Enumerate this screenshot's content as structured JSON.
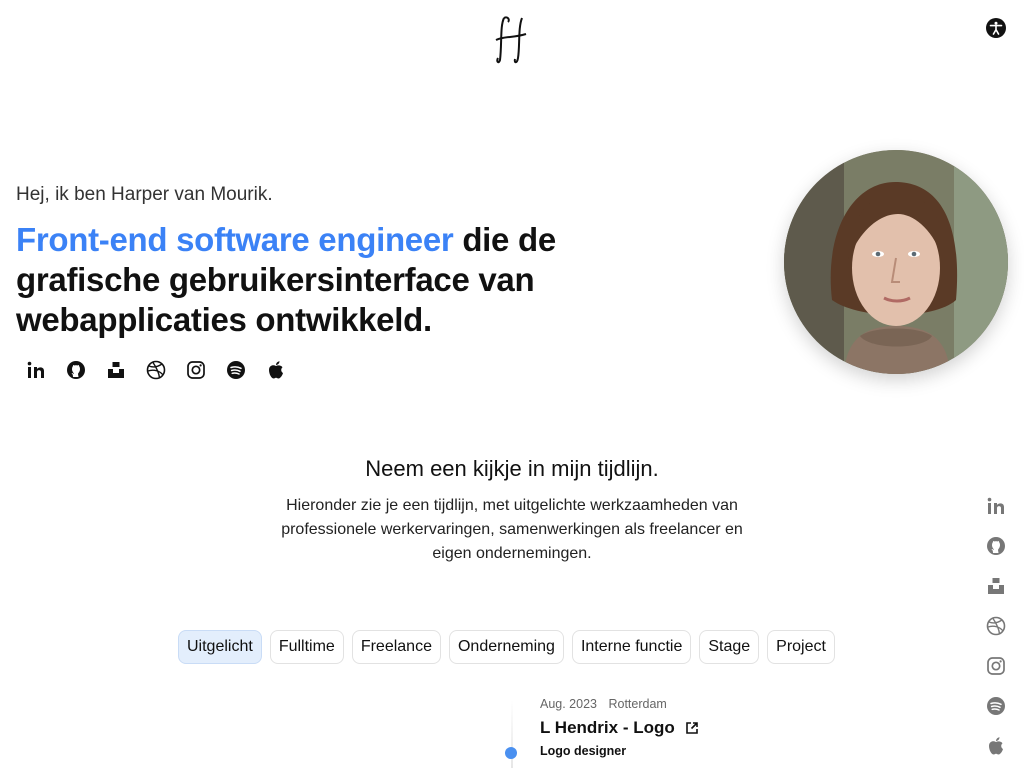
{
  "header": {
    "logo_icon": "signature-h-logo",
    "accessibility_icon": "accessibility-icon"
  },
  "hero": {
    "greeting": "Hej, ik ben Harper van Mourik.",
    "headline_accent": "Front-end software engineer",
    "headline_rest": " die de grafische gebruikersinterface van webapplicaties ontwikkeld."
  },
  "socials": [
    "linkedin-icon",
    "github-icon",
    "unsplash-icon",
    "dribbble-icon",
    "instagram-icon",
    "spotify-icon",
    "apple-icon"
  ],
  "timeline": {
    "title": "Neem een kijkje in mijn tijdlijn.",
    "description": "Hieronder zie je een tijdlijn, met uitgelichte werkzaamheden van professionele werkervaringen, samenwerkingen als freelancer en eigen ondernemingen.",
    "filters": [
      "Uitgelicht",
      "Fulltime",
      "Freelance",
      "Onderneming",
      "Interne functie",
      "Stage",
      "Project"
    ],
    "active_filter": "Uitgelicht",
    "entry": {
      "date": "Aug. 2023",
      "location": "Rotterdam",
      "title": "L Hendrix - Logo",
      "role": "Logo designer"
    }
  },
  "colors": {
    "accent": "#3b82f6",
    "dot": "#4a90f0",
    "chip_active": "#e3eefc"
  }
}
